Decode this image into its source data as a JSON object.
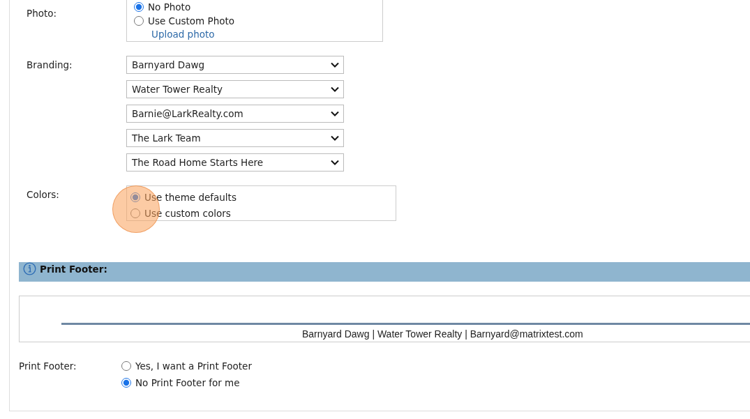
{
  "photo": {
    "label": "Photo:",
    "options": [
      {
        "label": "No Photo",
        "selected": true
      },
      {
        "label": "Use Custom Photo",
        "selected": false
      }
    ],
    "link": "Upload photo"
  },
  "branding": {
    "label": "Branding:",
    "selects": [
      "Barnyard Dawg",
      "Water Tower Realty",
      "Barnie@LarkRealty.com",
      "The Lark Team",
      "The Road Home Starts Here"
    ]
  },
  "colors": {
    "label": "Colors:",
    "options": [
      {
        "label": "Use theme defaults",
        "selected": true
      },
      {
        "label": "Use custom colors",
        "selected": false
      }
    ]
  },
  "click_highlight": {
    "shown": true
  },
  "print_footer_section": {
    "title": "Print Footer:",
    "preview_text": "Barnyard Dawg | Water Tower Realty | Barnyard@matrixtest.com",
    "label": "Print Footer:",
    "options": [
      {
        "label": "Yes, I want a Print Footer",
        "selected": false
      },
      {
        "label": "No Print Footer for me",
        "selected": true
      }
    ]
  }
}
